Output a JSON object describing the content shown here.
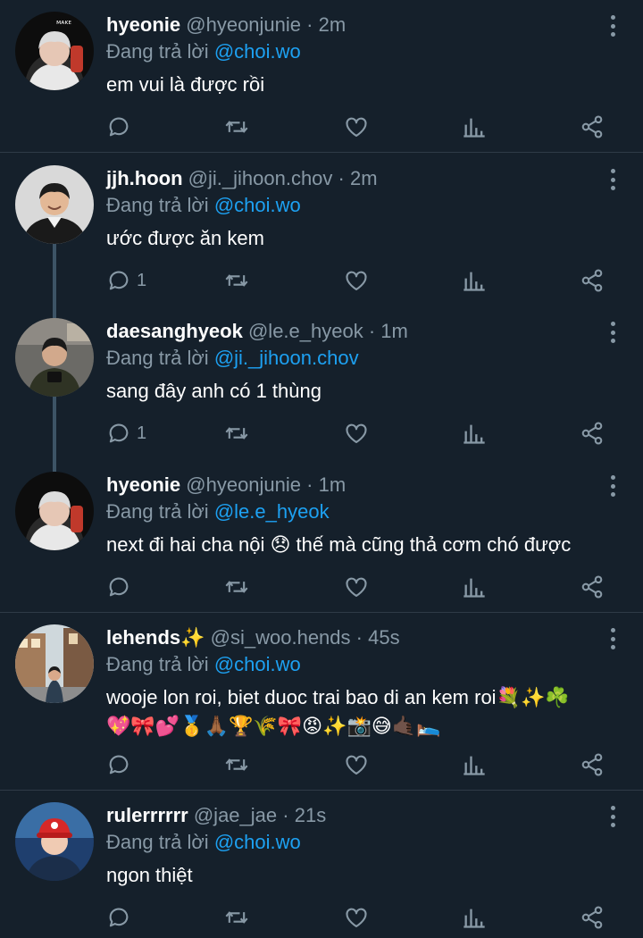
{
  "tweets": [
    {
      "name": "hyeonie",
      "handle": "@hyeonjunie",
      "time": "2m",
      "reply_prefix": "Đang trả lời",
      "reply_to": "@choi.wo",
      "text": "em vui là được rồi",
      "replies": "",
      "avatar_icon": "avatar-white-hair-gaming-chair"
    },
    {
      "name": "jjh.hoon",
      "handle": "@ji._jihoon.chov",
      "time": "2m",
      "reply_prefix": "Đang trả lời",
      "reply_to": "@choi.wo",
      "text": "ước được ăn kem",
      "replies": "1",
      "avatar_icon": "avatar-smiling-man"
    },
    {
      "name": "daesanghyeok",
      "handle": "@le.e_hyeok",
      "time": "1m",
      "reply_prefix": "Đang trả lời",
      "reply_to": "@ji._jihoon.chov",
      "text": "sang đây anh có 1 thùng",
      "replies": "1",
      "avatar_icon": "avatar-man-street"
    },
    {
      "name": "hyeonie",
      "handle": "@hyeonjunie",
      "time": "1m",
      "reply_prefix": "Đang trả lời",
      "reply_to": "@le.e_hyeok",
      "text": "next đi hai cha nội 😞 thế mà cũng thả cơm chó được",
      "replies": "",
      "avatar_icon": "avatar-white-hair-gaming-chair"
    },
    {
      "name": "lehends✨",
      "handle": "@si_woo.hends",
      "time": "45s",
      "reply_prefix": "Đang trả lời",
      "reply_to": "@choi.wo",
      "text": "wooje lon roi, biet duoc trai bao di an kem roi💐✨☘️",
      "text2": "💖🎀💕🥇🙏🏾🏆🌾🎀😡✨📸😅🤙🏿🛌",
      "replies": "",
      "avatar_icon": "avatar-street-buildings"
    },
    {
      "name": "rulerrrrrr",
      "handle": "@jae_jae",
      "time": "21s",
      "reply_prefix": "Đang trả lời",
      "reply_to": "@choi.wo",
      "text": "ngon thiệt",
      "replies": "",
      "avatar_icon": "avatar-red-cap"
    }
  ],
  "dot_separator": "·",
  "icons": {
    "reply": "reply-icon",
    "retweet": "retweet-icon",
    "like": "heart-icon",
    "stats": "stats-icon",
    "share": "share-icon",
    "more": "more-icon"
  },
  "colors": {
    "background": "#15202b",
    "secondary_text": "#8899a6",
    "mention": "#1da1f2",
    "divider": "#2f3b47",
    "thread_line": "#3d5466"
  }
}
